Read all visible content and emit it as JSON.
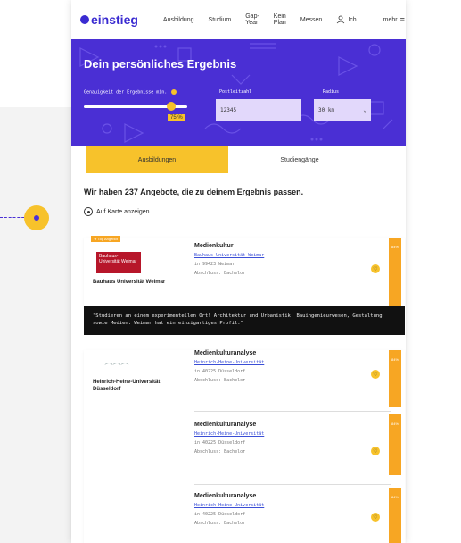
{
  "header": {
    "logo": "einstieg",
    "nav": [
      "Ausbildung",
      "Studium",
      "Gap-Year",
      "Kein Plan",
      "Messen"
    ],
    "user": "Ich",
    "more": "mehr"
  },
  "hero": {
    "title": "Dein persönliches Ergebnis",
    "slider_label": "Genauigkeit der Ergebnisse min.",
    "slider_value": "75 %",
    "slider_fraction": 0.75,
    "postal_label": "Postleitzahl",
    "postal_value": "12345",
    "radius_label": "Radius",
    "radius_value": "30 km"
  },
  "tabs": [
    "Ausbildungen",
    "Studiengänge"
  ],
  "results": {
    "heading": "Wir haben 237 Angebote, die zu deinem Ergebnis passen.",
    "map_link": "Auf Karte anzeigen"
  },
  "cards": [
    {
      "badge": "Top Angebot",
      "uni_logo": "Bauhaus-Universität Weimar",
      "uni_name": "Bauhaus Universität Weimar",
      "title": "Medienkultur",
      "link": "Bauhaus Universität Weimar",
      "location": "in 99423 Weimar",
      "degree": "Abschluss: Bachelor",
      "match": "84%",
      "quote": "\"Studieren an einem experimentellen Ort! Architektur und Urbanistik, Bauingenieurwesen, Gestaltung sowie Medien. Weimar hat ein einzigartiges Profil.\""
    },
    {
      "uni_name": "Heinrich-Heine-Universität Düsseldorf",
      "offers": [
        {
          "title": "Medienkulturanalyse",
          "link": "Heinrich-Heine-Universität",
          "location": "in 40225 Düsseldorf",
          "degree": "Abschluss: Bachelor",
          "match": "84%"
        },
        {
          "title": "Medienkulturanalyse",
          "link": "Heinrich-Heine-Universität",
          "location": "in 40225 Düsseldorf",
          "degree": "Abschluss: Bachelor",
          "match": "84%"
        },
        {
          "title": "Medienkulturanalyse",
          "link": "Heinrich-Heine-Universität",
          "location": "in 40225 Düsseldorf",
          "degree": "Abschluss: Bachelor",
          "match": "84%"
        }
      ]
    }
  ],
  "colors": {
    "brand": "#4a2fd4",
    "accent": "#f7c22b",
    "match_bar": "#f7a623",
    "uni_logo_red": "#b7162a"
  }
}
